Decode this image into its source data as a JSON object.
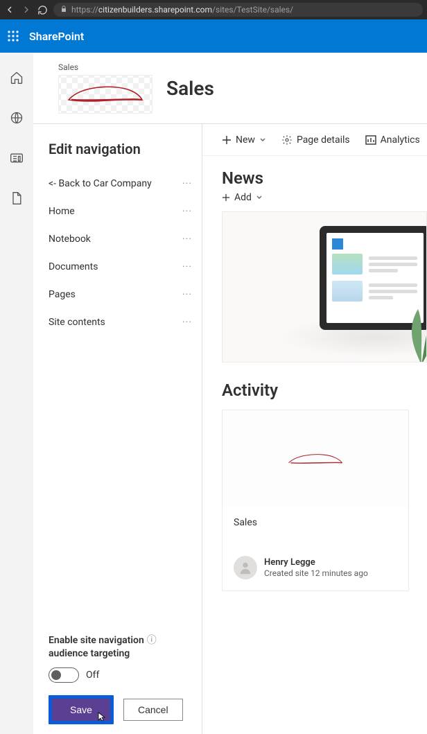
{
  "browser": {
    "url_domain": "citizenbuilders.sharepoint.com",
    "url_path": "/sites/TestSite/sales/",
    "url_prefix": "https://"
  },
  "suite": {
    "title": "SharePoint"
  },
  "site": {
    "breadcrumb": "Sales",
    "title": "Sales"
  },
  "editNav": {
    "heading": "Edit navigation",
    "items": [
      {
        "label": "<- Back to Car Company"
      },
      {
        "label": "Home"
      },
      {
        "label": "Notebook"
      },
      {
        "label": "Documents"
      },
      {
        "label": "Pages"
      },
      {
        "label": "Site contents"
      }
    ],
    "audienceTargeting": {
      "label_line1": "Enable site navigation",
      "label_line2": "audience targeting",
      "state_text": "Off"
    },
    "save_label": "Save",
    "cancel_label": "Cancel"
  },
  "cmdBar": {
    "new_label": "New",
    "page_details_label": "Page details",
    "analytics_label": "Analytics"
  },
  "news": {
    "title": "News",
    "add_label": "Add"
  },
  "activity": {
    "title": "Activity",
    "card": {
      "title": "Sales",
      "user": "Henry Legge",
      "action": "Created site 12 minutes ago"
    }
  }
}
